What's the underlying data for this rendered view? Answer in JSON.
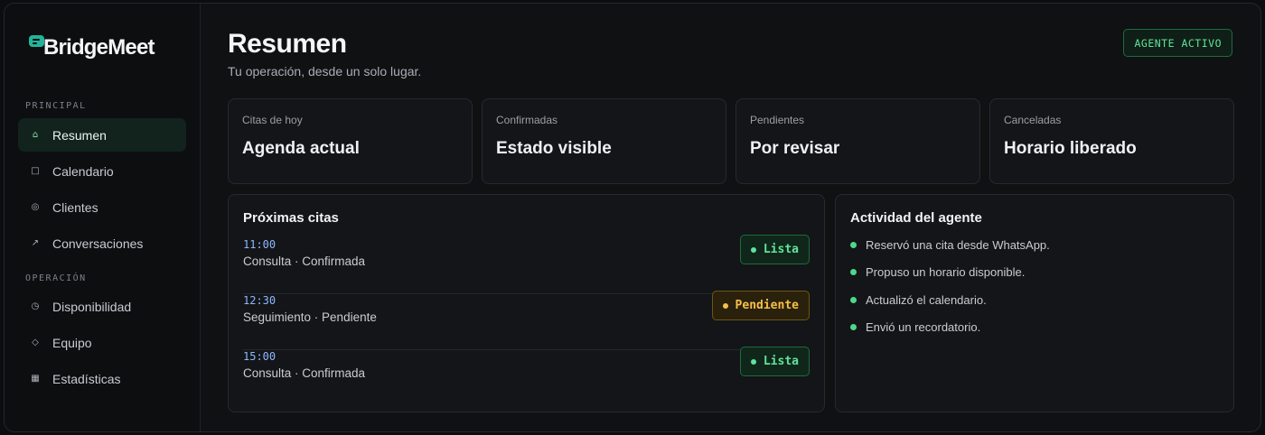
{
  "brand": {
    "name": "BridgeMeet",
    "accent": "#22b39a",
    "logo_icon": "chat-bubble-icon"
  },
  "sidebar": {
    "sections": [
      {
        "label": "PRINCIPAL"
      },
      {
        "label": "OPERACIÓN"
      }
    ],
    "items": [
      {
        "label": "Resumen",
        "icon": "home-icon",
        "active": true
      },
      {
        "label": "Calendario",
        "icon": "square-icon"
      },
      {
        "label": "Clientes",
        "icon": "target-icon"
      },
      {
        "label": "Conversaciones",
        "icon": "arrow-up-right-icon"
      },
      {
        "label": "Disponibilidad",
        "icon": "clock-icon"
      },
      {
        "label": "Equipo",
        "icon": "diamond-icon"
      },
      {
        "label": "Estadísticas",
        "icon": "bar-square-icon"
      }
    ]
  },
  "header": {
    "title": "Resumen",
    "subtitle": "Tu operación, desde un solo lugar.",
    "status_badge": "AGENTE ACTIVO"
  },
  "stats": [
    {
      "label": "Citas de hoy",
      "value": "Agenda actual"
    },
    {
      "label": "Confirmadas",
      "value": "Estado visible"
    },
    {
      "label": "Pendientes",
      "value": "Por revisar"
    },
    {
      "label": "Canceladas",
      "value": "Horario liberado"
    }
  ],
  "appointments": {
    "title": "Próximas citas",
    "items": [
      {
        "time": "11:00",
        "desc": "Consulta · Confirmada",
        "status": "Lista",
        "status_color": "#5fe49a"
      },
      {
        "time": "12:30",
        "desc": "Seguimiento · Pendiente",
        "status": "Pendiente",
        "status_color": "#f5c04a"
      },
      {
        "time": "15:00",
        "desc": "Consulta · Confirmada",
        "status": "Lista",
        "status_color": "#5fe49a"
      }
    ]
  },
  "activity": {
    "title": "Actividad del agente",
    "items": [
      "Reservó una cita desde WhatsApp.",
      "Propuso un horario disponible.",
      "Actualizó el calendario.",
      "Envió un recordatorio."
    ]
  }
}
